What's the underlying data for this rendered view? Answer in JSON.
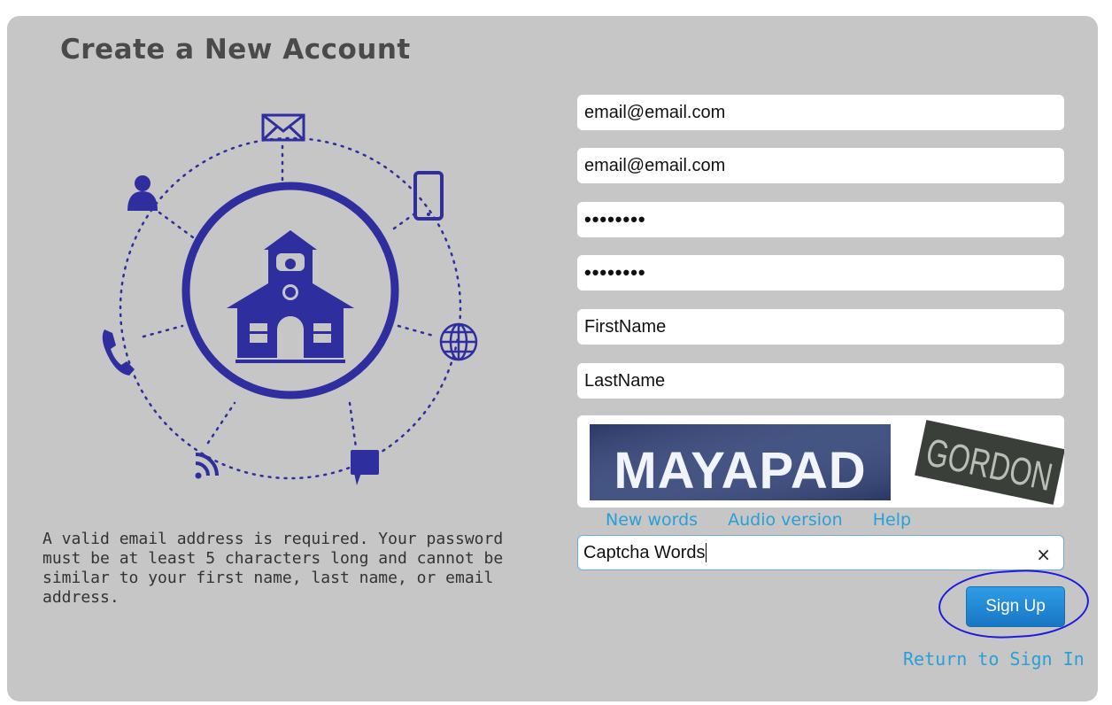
{
  "page": {
    "title": "Create a New Account",
    "help_text": "A valid email address is required. Your password must be at least 5 characters long and cannot be similar to your first name, last name, or email address."
  },
  "form": {
    "email": "email@email.com",
    "email_confirm": "email@email.com",
    "password": "••••••••",
    "password_confirm": "••••••••",
    "first_name": "FirstName",
    "last_name": "LastName",
    "captcha_word_1": "MAYAPAD",
    "captcha_word_2": "GORDON",
    "captcha_links": {
      "new_words": "New words",
      "audio": "Audio version",
      "help": "Help"
    },
    "captcha_input": "Captcha Words",
    "clear_glyph": "×",
    "sign_up_label": "Sign Up",
    "return_label": "Return to Sign In"
  },
  "illustration_icons": [
    "envelope-icon",
    "phone-icon",
    "user-icon",
    "telephone-icon",
    "globe-icon",
    "rss-icon",
    "chat-icon",
    "schoolhouse-icon"
  ],
  "colors": {
    "panel": "#c6c6c6",
    "illustration": "#2e2e9e",
    "link": "#2a9fd6",
    "button": "#1f86d3",
    "annotation": "#1b1be0"
  }
}
